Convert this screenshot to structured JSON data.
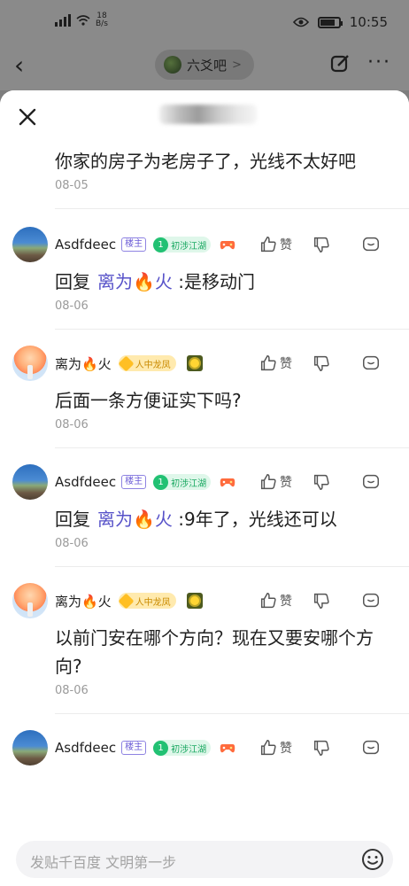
{
  "status_bar": {
    "speed_value": "18",
    "speed_unit": "B/s",
    "time": "10:55"
  },
  "header": {
    "forum_name": "六爻吧",
    "forum_chevron": ">"
  },
  "sheet": {
    "close_label": "×"
  },
  "comments": [
    {
      "username": "",
      "text": "你家的房子为老房子了，光线不太好吧",
      "date": "08-05"
    },
    {
      "username": "Asdfdeec",
      "owner_tag": "楼主",
      "level_num": "1",
      "level_label": "初涉江湖",
      "reply_prefix": "回复",
      "mention": "离为🔥火",
      "text": " :是移动门",
      "date": "08-06",
      "like_label": "赞"
    },
    {
      "username": "离为🔥火",
      "level_label": "人中龙凤",
      "text": "后面一条方便证实下吗?",
      "date": "08-06",
      "like_label": "赞"
    },
    {
      "username": "Asdfdeec",
      "owner_tag": "楼主",
      "level_num": "1",
      "level_label": "初涉江湖",
      "reply_prefix": "回复",
      "mention": "离为🔥火",
      "text": " :9年了，光线还可以",
      "date": "08-06",
      "like_label": "赞"
    },
    {
      "username": "离为🔥火",
      "level_label": "人中龙凤",
      "text": "以前门安在哪个方向？现在又要安哪个方向?",
      "date": "08-06",
      "like_label": "赞"
    },
    {
      "username": "Asdfdeec",
      "owner_tag": "楼主",
      "level_num": "1",
      "level_label": "初涉江湖",
      "like_label": "赞"
    }
  ],
  "input": {
    "placeholder": "发贴千百度 文明第一步"
  }
}
